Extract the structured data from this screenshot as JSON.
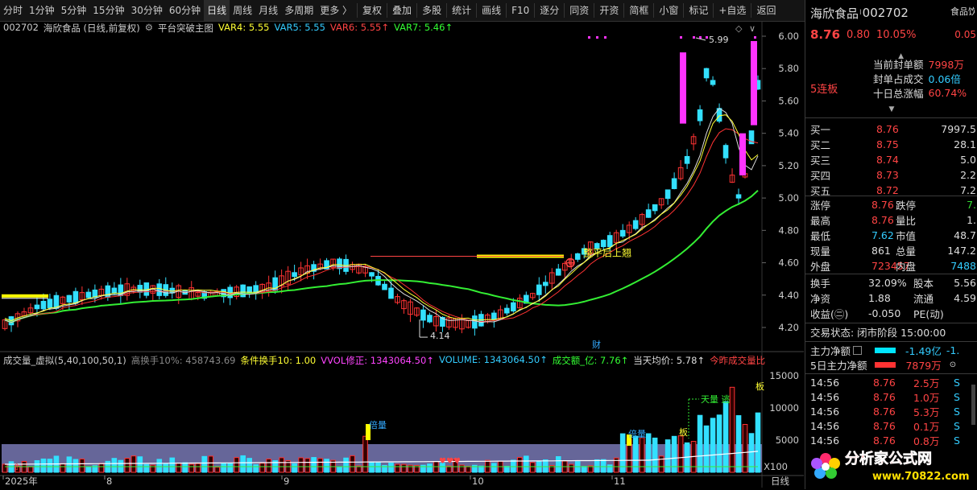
{
  "toolbar": {
    "periods": [
      "分时",
      "1分钟",
      "5分钟",
      "15分钟",
      "30分钟",
      "60分钟",
      "日线",
      "周线",
      "月线",
      "多周期",
      "更多 〉"
    ],
    "active_period": "日线",
    "tools": [
      "复权",
      "叠加",
      "多股",
      "统计",
      "画线",
      "F10",
      "逐分",
      "同资",
      "开资",
      "简框",
      "小窗",
      "标记",
      "+自选",
      "返回"
    ]
  },
  "chart_header": {
    "code": "002702",
    "name": "海欣食品 (日线,前复权)",
    "indicator": "平台突破主图",
    "vars": [
      {
        "label": "VAR4: 5.55",
        "color": "#ffff33"
      },
      {
        "label": "VAR5: 5.55",
        "color": "#33ccff"
      },
      {
        "label": "VAR6: 5.55↑",
        "color": "#ff4444"
      },
      {
        "label": "VAR7: 5.46↑",
        "color": "#33ff33"
      }
    ]
  },
  "price_axis": [
    "6.00",
    "5.80",
    "5.60",
    "5.40",
    "5.20",
    "5.00",
    "4.80",
    "4.60",
    "4.40",
    "4.20"
  ],
  "annotations": {
    "high_label": "5.99",
    "low_label": "4.14",
    "breakout_text": "整平后上翘",
    "cai": "财",
    "tian_liang": "天量 逃",
    "bei_liang_1": "倍量",
    "bei_liang_2": "倍量",
    "ban": "板",
    "ban2": "板"
  },
  "volume_header": {
    "title": "成交量_虚拟(5,40,100,50,1)",
    "items": [
      {
        "label": "高换手10%: 458743.69",
        "color": "#888888"
      },
      {
        "label": "条件换手10: 1.00",
        "color": "#ffff33"
      },
      {
        "label": "VVOL修正: 1343064.50↑",
        "color": "#ff44ff"
      },
      {
        "label": "VOLUME: 1343064.50↑",
        "color": "#33ccff"
      },
      {
        "label": "成交额_亿: 7.76↑",
        "color": "#33ff33"
      },
      {
        "label": "当天均价: 5.78↑",
        "color": "#dddddd"
      },
      {
        "label": "今昨成交量比",
        "color": "#ff4444"
      }
    ]
  },
  "volume_axis": [
    "15000",
    "10000",
    "5000",
    "X100"
  ],
  "date_axis": [
    "2025年",
    "8",
    "9",
    "10",
    "11"
  ],
  "period_label": "日线",
  "quote": {
    "name": "海欣食品",
    "code": "002702",
    "sector": "食品饮",
    "price": "8.76",
    "change": "0.80",
    "pct": "10.05%",
    "pct2": "0.05",
    "board_count": "5连板",
    "seal_amount_label": "当前封单额",
    "seal_amount": "7998万",
    "seal_ratio_label": "封单占成交",
    "seal_ratio": "0.06倍",
    "ten_day_label": "十日总涨幅",
    "ten_day": "60.74%",
    "bids": [
      {
        "label": "买一",
        "price": "8.76",
        "vol": "7997.5"
      },
      {
        "label": "买二",
        "price": "8.75",
        "vol": "28.1"
      },
      {
        "label": "买三",
        "price": "8.74",
        "vol": "5.0"
      },
      {
        "label": "买四",
        "price": "8.73",
        "vol": "2.2"
      },
      {
        "label": "买五",
        "price": "8.72",
        "vol": "7.2"
      }
    ],
    "stats": [
      {
        "l1": "涨停",
        "v1": "8.76",
        "c1": "red",
        "l2": "跌停",
        "v2": "7.",
        "c2": "green"
      },
      {
        "l1": "最高",
        "v1": "8.76",
        "c1": "red",
        "l2": "量比",
        "v2": "1.",
        "c2": "white"
      },
      {
        "l1": "最低",
        "v1": "7.62",
        "c1": "cyan",
        "l2": "市值",
        "v2": "48.7",
        "c2": "white"
      },
      {
        "l1": "现量",
        "v1": "861",
        "c1": "white",
        "l2": "总量",
        "v2": "147.2",
        "c2": "white"
      },
      {
        "l1": "外盘",
        "v1": "723457",
        "c1": "red",
        "l2": "内盘",
        "v2": "7488",
        "c2": "cyan"
      }
    ],
    "stats2": [
      {
        "l1": "换手",
        "v1": "32.09%",
        "c1": "white",
        "l2": "股本",
        "v2": "5.56",
        "c2": "white"
      },
      {
        "l1": "净资",
        "v1": "1.88",
        "c1": "white",
        "l2": "流通",
        "v2": "4.59",
        "c2": "white"
      },
      {
        "l1": "收益(㊁)",
        "v1": "-0.050",
        "c1": "white",
        "l2": "PE(动)",
        "v2": "",
        "c2": "white"
      }
    ],
    "trade_status": "交易状态: 闭市阶段 15:00:00",
    "main_flow_label": "主力净额",
    "main_flow": "-1.49亿",
    "main_flow2": "-1.",
    "five_day_label": "5日主力净额",
    "five_day": "7879万",
    "ticks": [
      {
        "time": "14:56",
        "price": "8.76",
        "vol": "2.5万",
        "side": "S"
      },
      {
        "time": "14:56",
        "price": "8.76",
        "vol": "1.0万",
        "side": "S"
      },
      {
        "time": "14:56",
        "price": "8.76",
        "vol": "5.3万",
        "side": "S"
      },
      {
        "time": "14:56",
        "price": "8.76",
        "vol": "0.1万",
        "side": "S"
      },
      {
        "time": "14:56",
        "price": "8.76",
        "vol": "0.8万",
        "side": "S"
      }
    ]
  },
  "watermark": {
    "title": "分析家公式网",
    "url": "www.70822.com"
  }
}
